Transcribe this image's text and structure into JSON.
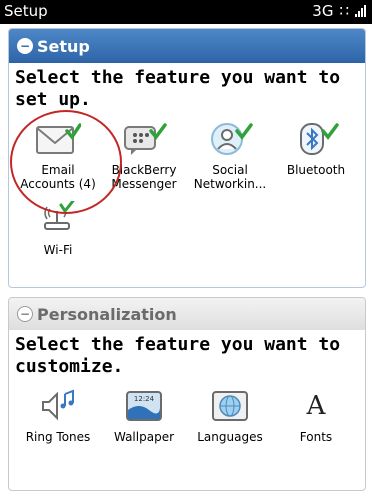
{
  "status_bar": {
    "title": "Setup",
    "network": "3G",
    "signal_glyph": "∷"
  },
  "setup": {
    "title": "Setup",
    "prompt": "Select the feature you want to set up.",
    "items": [
      {
        "label": "Email Accounts (4)"
      },
      {
        "label": "BlackBerry Messenger"
      },
      {
        "label": "Social Networkin..."
      },
      {
        "label": "Bluetooth"
      },
      {
        "label": "Wi-Fi"
      }
    ]
  },
  "personalization": {
    "title": "Personalization",
    "prompt": "Select the feature you want to customize.",
    "items": [
      {
        "label": "Ring Tones"
      },
      {
        "label": "Wallpaper",
        "time": "12:24"
      },
      {
        "label": "Languages"
      },
      {
        "label": "Fonts",
        "glyph": "A"
      }
    ]
  },
  "colors": {
    "header_blue": "#2d64a8",
    "checkmark": "#2fa33a",
    "highlight_circle": "#c42626"
  }
}
